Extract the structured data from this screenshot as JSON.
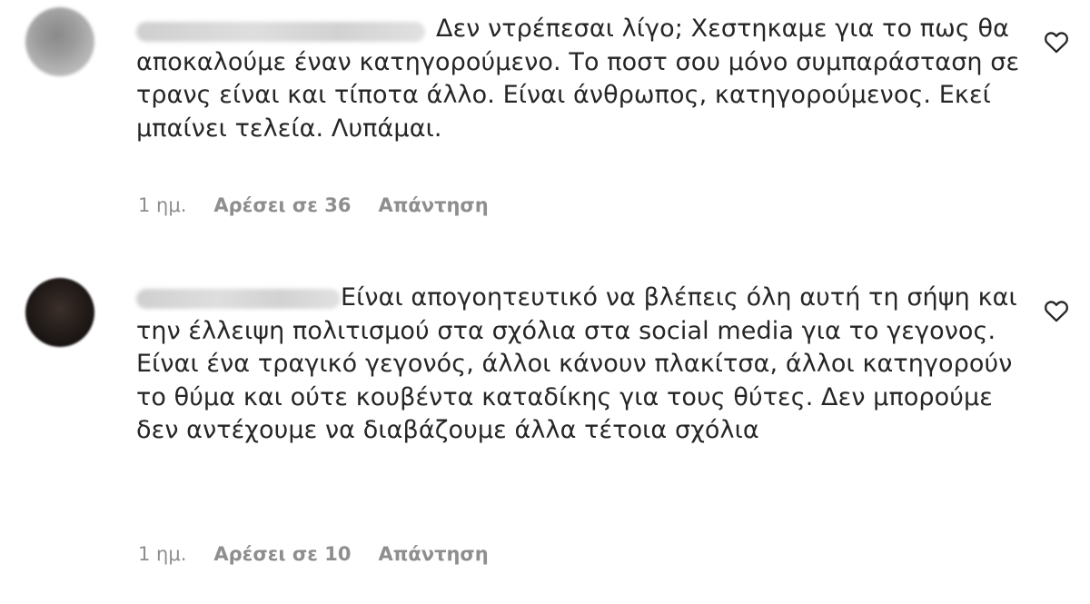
{
  "comments": [
    {
      "text": "Δεν ντρέπεσαι λίγο; Χεστηκαμε για το πως θα αποκαλούμε έναν κατηγορούμενο. Το ποστ σου μόνο συμπαράσταση σε τρανς είναι και τίποτα άλλο. Είναι άνθρωπος, κατηγορούμενος. Εκεί μπαίνει τελεία. Λυπάμαι.",
      "time": "1 ημ.",
      "likes": "Αρέσει σε 36",
      "reply": "Απάντηση",
      "icon": "heart-outline-icon"
    },
    {
      "text": "Είναι απογοητευτικό να βλέπεις όλη αυτή τη σήψη και την έλλειψη πολιτισμού στα σχόλια στα social media για το γεγονος. Είναι ένα τραγικό γεγονός, άλλοι κάνουν πλακίτσα, άλλοι κατηγορούν το θύμα και ούτε κουβέντα καταδίκης για τους θύτες. Δεν μπορούμε δεν αντέχουμε να διαβάζουμε άλλα τέτοια σχόλια",
      "time": "1 ημ.",
      "likes": "Αρέσει σε 10",
      "reply": "Απάντηση",
      "icon": "heart-outline-icon"
    }
  ],
  "colors": {
    "text": "#262626",
    "meta": "#8e8e8e",
    "background": "#ffffff"
  }
}
